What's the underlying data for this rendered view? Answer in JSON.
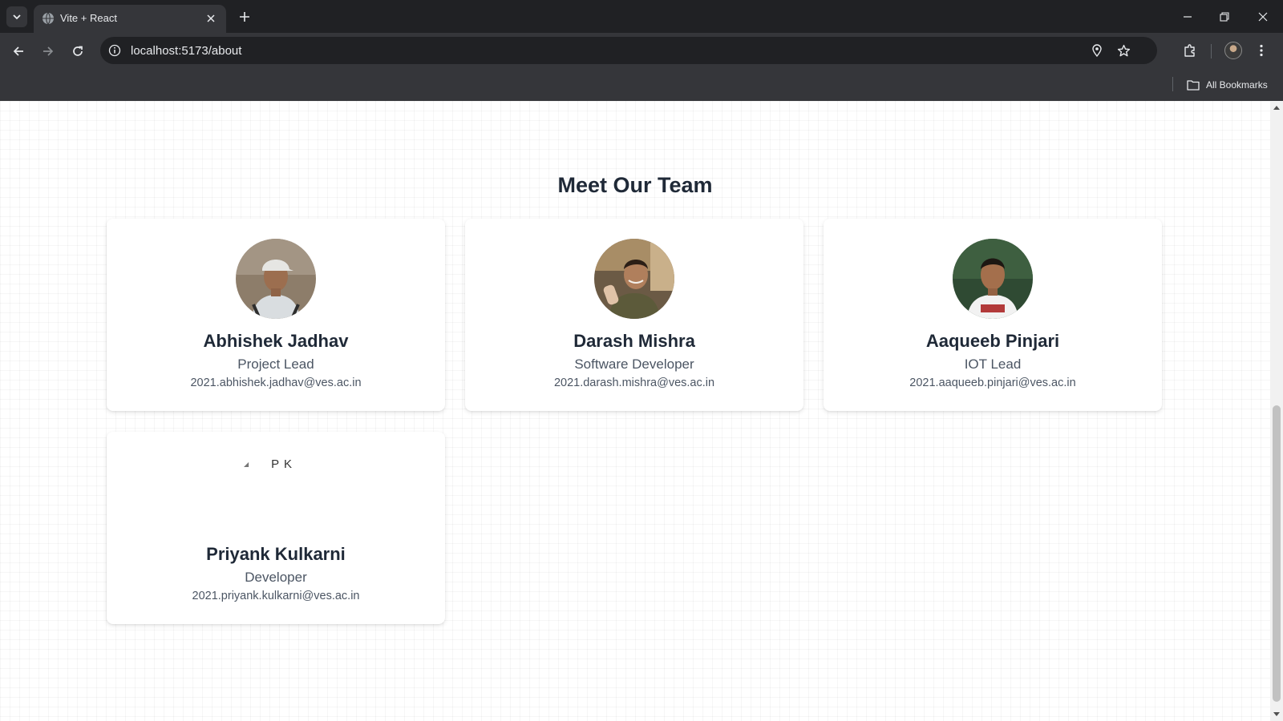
{
  "browser": {
    "tab_title": "Vite + React",
    "url": "localhost:5173/about",
    "bookmarks_label": "All Bookmarks"
  },
  "page": {
    "heading": "Meet Our Team",
    "members": [
      {
        "name": "Abhishek Jadhav",
        "role": "Project Lead",
        "email": "2021.abhishek.jadhav@ves.ac.in"
      },
      {
        "name": "Darash Mishra",
        "role": "Software Developer",
        "email": "2021.darash.mishra@ves.ac.in"
      },
      {
        "name": "Aaqueeb Pinjari",
        "role": "IOT Lead",
        "email": "2021.aaqueeb.pinjari@ves.ac.in"
      },
      {
        "name": "Priyank Kulkarni",
        "role": "Developer",
        "email": "2021.priyank.kulkarni@ves.ac.in",
        "image_alt": "P K"
      }
    ]
  },
  "colors": {
    "chrome_dark": "#202124",
    "chrome_toolbar": "#35363a",
    "text_primary": "#1f2937",
    "text_secondary": "#4b5563"
  },
  "icons": [
    "tab-list-icon",
    "favicon-icon",
    "close-icon",
    "plus-icon",
    "minimize-icon",
    "restore-icon",
    "back-icon",
    "forward-icon",
    "reload-icon",
    "info-icon",
    "location-icon",
    "star-icon",
    "extensions-icon",
    "kebab-menu-icon",
    "folder-icon"
  ]
}
